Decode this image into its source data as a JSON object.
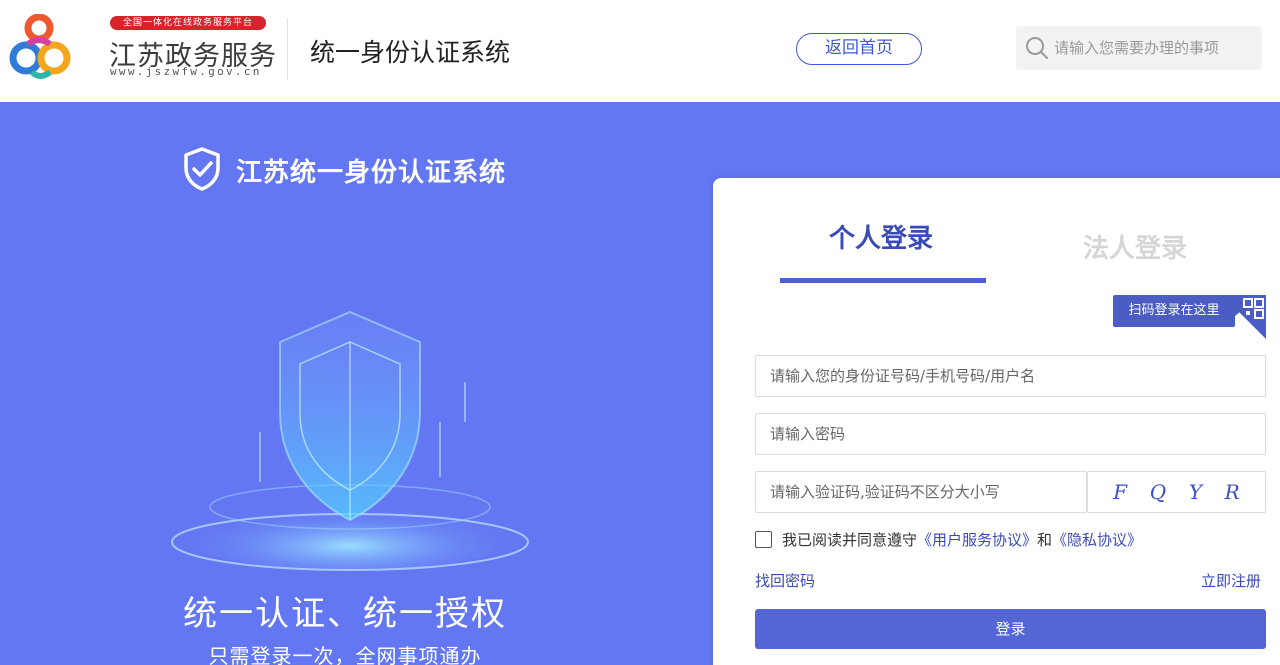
{
  "header": {
    "brand_badge": "全国一体化在线政务服务平台",
    "brand_name": "江苏政务服务",
    "brand_url": "www.jszwfw.gov.cn",
    "system_title": "统一身份认证系统",
    "home_button": "返回首页",
    "search_placeholder": "请输入您需要办理的事项"
  },
  "hero": {
    "title": "江苏统一身份认证系统",
    "slogan": "统一认证、统一授权",
    "subtitle": "只需登录一次，全网事项通办"
  },
  "login": {
    "tabs": [
      {
        "label": "个人登录",
        "active": true
      },
      {
        "label": "法人登录",
        "active": false
      }
    ],
    "qr_tip": "扫码登录在这里",
    "username_placeholder": "请输入您的身份证号码/手机号码/用户名",
    "password_placeholder": "请输入密码",
    "captcha_placeholder": "请输入验证码,验证码不区分大小写",
    "captcha_chars": [
      "F",
      "Q",
      "Y",
      "R"
    ],
    "agreement_prefix": "我已阅读并同意遵守",
    "agreement_link1": "《用户服务协议》",
    "agreement_and": "和",
    "agreement_link2": "《隐私协议》",
    "forgot_password": "找回密码",
    "register": "立即注册",
    "submit": "登录"
  },
  "colors": {
    "hero_bg": "#6377f2",
    "accent": "#3a4bb8",
    "button": "#5466d4",
    "badge_red": "#d7242b"
  }
}
